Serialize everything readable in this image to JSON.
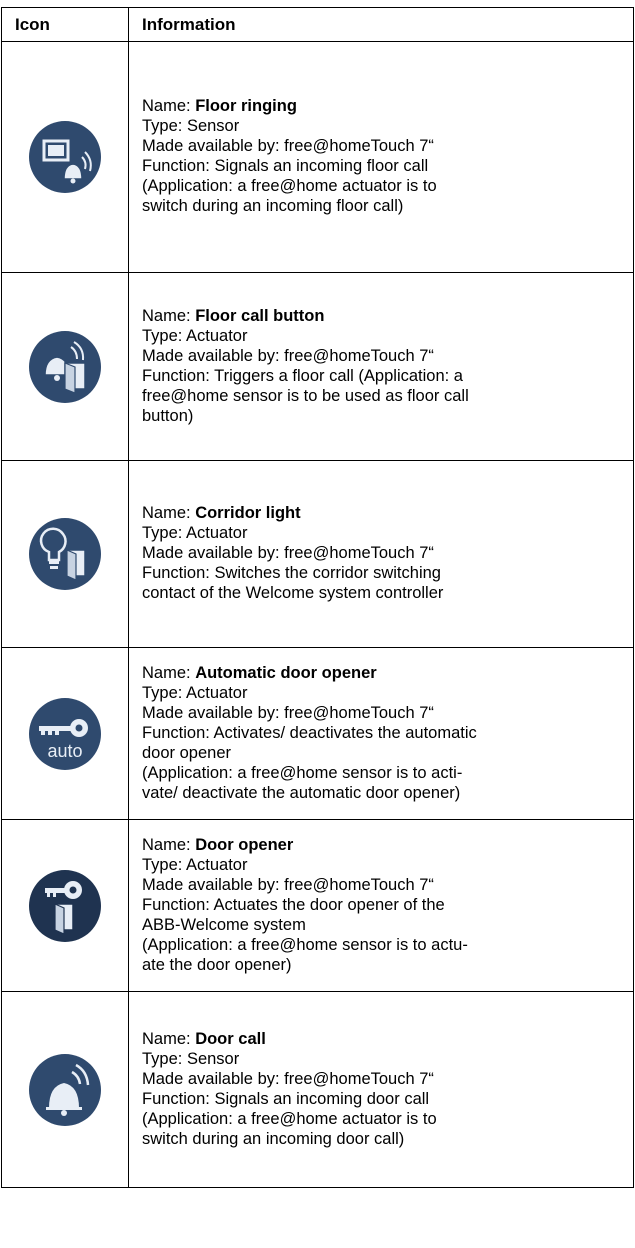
{
  "header": {
    "icon": "Icon",
    "information": "Information"
  },
  "rows": [
    {
      "icon": "floor-ringing-icon",
      "name_label": "Name: ",
      "name": "Floor ringing",
      "type": "Type: Sensor",
      "made": "Made available by: free@homeTouch 7“",
      "function_lines": [
        "Function: Signals an incoming floor call",
        "(Application: a free@home actuator is to",
        "switch during an incoming floor call)"
      ]
    },
    {
      "icon": "floor-call-button-icon",
      "name_label": "Name: ",
      "name": "Floor call button",
      "type": "Type: Actuator",
      "made": "Made available by: free@homeTouch 7“",
      "function_lines": [
        "Function: Triggers a floor call (Application: a",
        "free@home sensor is to be used as floor call",
        "button)"
      ]
    },
    {
      "icon": "corridor-light-icon",
      "name_label": "Name: ",
      "name": "Corridor light",
      "type": "Type: Actuator",
      "made": "Made available by: free@homeTouch 7“",
      "function_lines": [
        "Function: Switches the corridor switching",
        "contact of the Welcome system controller"
      ]
    },
    {
      "icon": "automatic-door-opener-icon",
      "icon_text": "auto",
      "name_label": "Name: ",
      "name": "Automatic door opener",
      "type": "Type: Actuator",
      "made": "Made available by: free@homeTouch 7“",
      "function_lines": [
        "Function: Activates/ deactivates the automatic",
        "door opener",
        "(Application: a free@home sensor is to acti-",
        "vate/ deactivate the automatic door opener)"
      ]
    },
    {
      "icon": "door-opener-icon",
      "name_label": "Name: ",
      "name": "Door opener",
      "type": "Type: Actuator",
      "made": "Made available by: free@homeTouch 7“",
      "function_lines": [
        "Function: Actuates the door opener of the",
        "ABB-Welcome system",
        "(Application: a free@home sensor is to actu-",
        "ate the door opener)"
      ]
    },
    {
      "icon": "door-call-icon",
      "name_label": "Name: ",
      "name": "Door call",
      "type": "Type: Sensor",
      "made": "Made available by: free@homeTouch 7“",
      "function_lines": [
        "Function: Signals an incoming door call",
        "(Application: a free@home actuator is to",
        "switch during an incoming door call)"
      ]
    }
  ],
  "colors": {
    "icon_bg": "#2f4a6e",
    "icon_bg_dark": "#1f3350",
    "icon_fg": "#e8eef6"
  }
}
